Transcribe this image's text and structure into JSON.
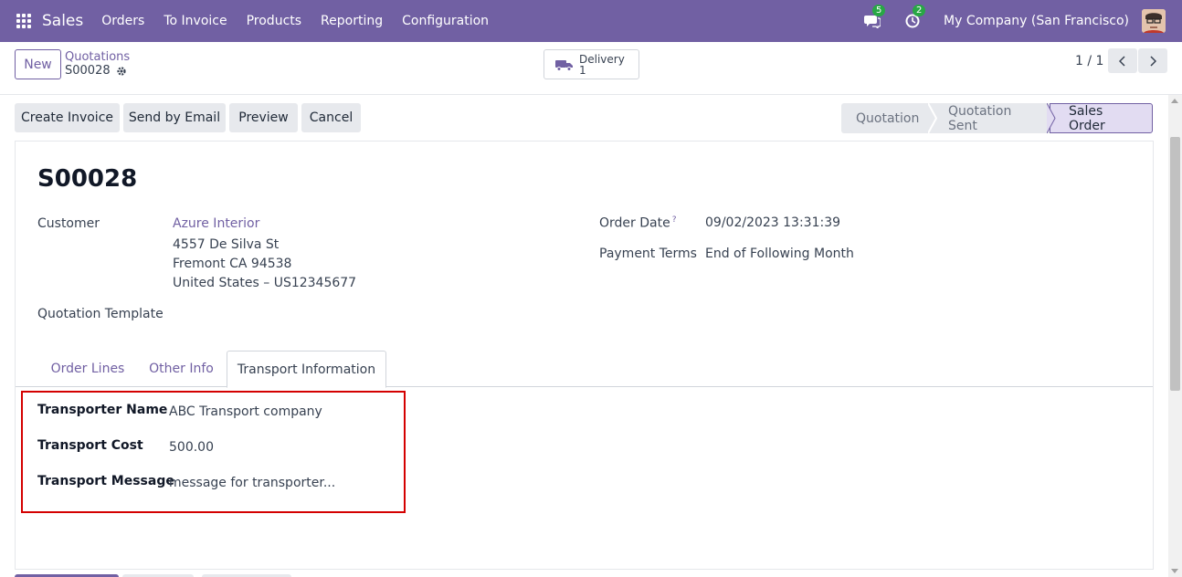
{
  "navbar": {
    "app_name": "Sales",
    "menu": [
      "Orders",
      "To Invoice",
      "Products",
      "Reporting",
      "Configuration"
    ],
    "messages_count": "5",
    "activities_count": "2",
    "company": "My Company (San Francisco)",
    "apps_icon": "grid-icon",
    "messages_icon": "chat-icon",
    "activities_icon": "clock-icon"
  },
  "control": {
    "new_label": "New",
    "breadcrumb_parent": "Quotations",
    "breadcrumb_current": "S00028",
    "smart_button_label": "Delivery",
    "smart_button_count": "1",
    "pager": "1 / 1"
  },
  "actions": [
    "Create Invoice",
    "Send by Email",
    "Preview",
    "Cancel"
  ],
  "statusbar": [
    "Quotation",
    "Quotation Sent",
    "Sales Order"
  ],
  "record": {
    "name": "S00028",
    "customer_label": "Customer",
    "customer_name": "Azure Interior",
    "address_line1": "4557 De Silva St",
    "address_line2": "Fremont CA 94538",
    "address_line3": "United States – US12345677",
    "template_label": "Quotation Template",
    "order_date_label": "Order Date",
    "order_date_help": "?",
    "order_date": "09/02/2023 13:31:39",
    "payment_terms_label": "Payment Terms",
    "payment_terms": "End of Following Month"
  },
  "tabs": [
    "Order Lines",
    "Other Info",
    "Transport Information"
  ],
  "transport": {
    "name_label": "Transporter Name",
    "name_value": "ABC Transport company",
    "cost_label": "Transport Cost",
    "cost_value": "500.00",
    "message_label": "Transport Message",
    "message_value": "message for transporter..."
  },
  "colors": {
    "brand": "#7160a3",
    "highlight_box": "#d40000",
    "badge": "#28a745"
  }
}
